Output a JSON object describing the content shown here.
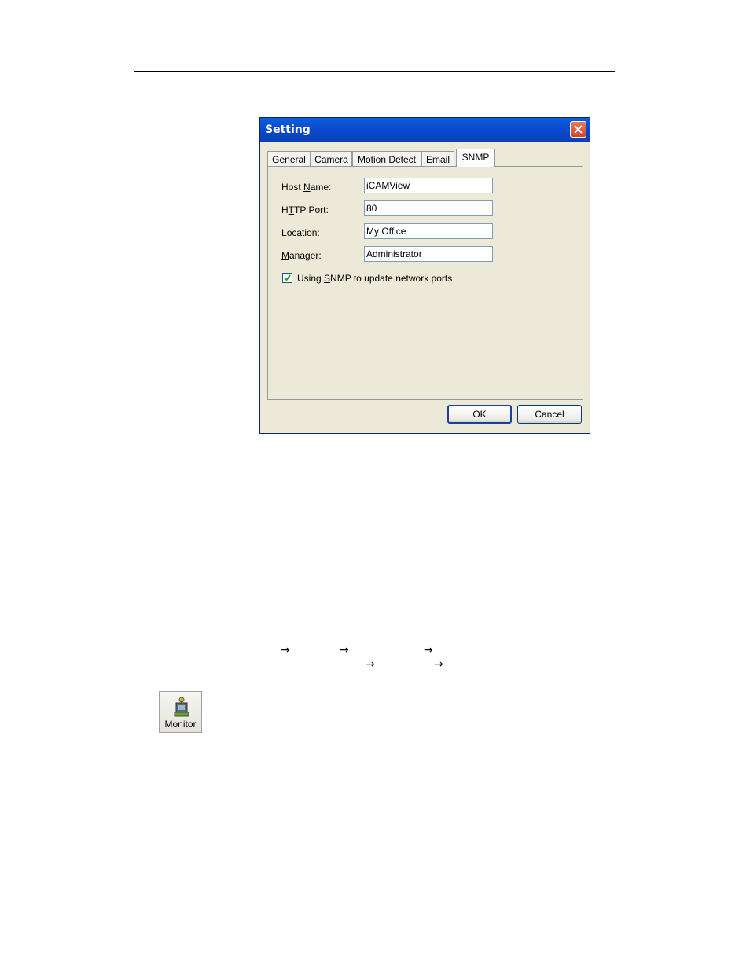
{
  "dialog": {
    "title": "Setting",
    "tabs": [
      {
        "label": "General"
      },
      {
        "label": "Camera"
      },
      {
        "label": "Motion Detect"
      },
      {
        "label": "Email"
      },
      {
        "label": "SNMP"
      }
    ],
    "active_tab": "SNMP",
    "fields": {
      "host_name": {
        "label_pre": "Host ",
        "label_key": "N",
        "label_post": "ame:",
        "value": "iCAMView"
      },
      "http_port": {
        "label_pre": "H",
        "label_key": "T",
        "label_post": "TP Port:",
        "value": "80"
      },
      "location": {
        "label_pre": "",
        "label_key": "L",
        "label_post": "ocation:",
        "value": "My Office"
      },
      "manager": {
        "label_pre": "",
        "label_key": "M",
        "label_post": "anager:",
        "value": "Administrator"
      }
    },
    "snmp_checkbox": {
      "label_pre": "Using ",
      "label_key": "S",
      "label_post": "NMP to update network ports",
      "checked": true
    },
    "ok_label": "OK",
    "cancel_label": "Cancel"
  },
  "body": {
    "arrow_glyph": "→"
  },
  "monitor_button": {
    "label": "Monitor",
    "icon": "monitor-icon"
  }
}
